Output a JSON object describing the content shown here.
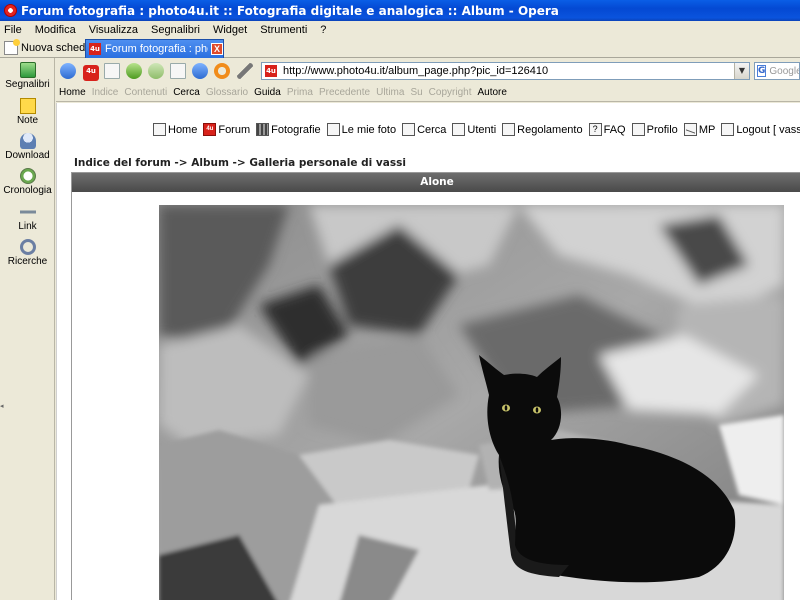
{
  "window": {
    "title": "Forum fotografia : photo4u.it :: Fotografia digitale e analogica :: Album - Opera"
  },
  "menu": [
    "File",
    "Modifica",
    "Visualizza",
    "Segnalibri",
    "Widget",
    "Strumenti",
    "?"
  ],
  "tabs": {
    "new_tab_label": "Nuova scheda",
    "active_tab_title": "Forum fotografia : photo...",
    "site_icon_text": "4u",
    "close_symbol": "X"
  },
  "panel": {
    "items": [
      "Segnalibri",
      "Note",
      "Download",
      "Cronologia",
      "Link",
      "Ricerche"
    ]
  },
  "address": {
    "url": "http://www.photo4u.it/album_page.php?pic_id=126410",
    "dropdown_symbol": "▼",
    "search_engine_icon": "G",
    "search_placeholder": "Google"
  },
  "navbar": {
    "items": [
      {
        "label": "Home",
        "enabled": true
      },
      {
        "label": "Indice",
        "enabled": false
      },
      {
        "label": "Contenuti",
        "enabled": false
      },
      {
        "label": "Cerca",
        "enabled": true
      },
      {
        "label": "Glossario",
        "enabled": false
      },
      {
        "label": "Guida",
        "enabled": true
      },
      {
        "label": "Prima",
        "enabled": false
      },
      {
        "label": "Precedente",
        "enabled": false
      },
      {
        "label": "Ultima",
        "enabled": false
      },
      {
        "label": "Su",
        "enabled": false
      },
      {
        "label": "Copyright",
        "enabled": false
      },
      {
        "label": "Autore",
        "enabled": true
      }
    ]
  },
  "forum": {
    "links": [
      {
        "label": "Home",
        "icon": "home-icon"
      },
      {
        "label": "Forum",
        "icon": "forum-logo-icon",
        "icon_text": "4u"
      },
      {
        "label": "Fotografie",
        "icon": "film-icon"
      },
      {
        "label": "Le mie foto",
        "icon": "my-photos-icon"
      },
      {
        "label": "Cerca",
        "icon": "search-icon"
      },
      {
        "label": "Utenti",
        "icon": "users-icon"
      },
      {
        "label": "Regolamento",
        "icon": "rules-icon"
      },
      {
        "label": "FAQ",
        "icon": "faq-icon",
        "icon_text": "?"
      },
      {
        "label": "Profilo",
        "icon": "profile-icon"
      },
      {
        "label": "MP",
        "icon": "mail-icon"
      },
      {
        "label": "Logout [ vassi ]",
        "icon": "logout-icon"
      }
    ],
    "breadcrumb": "Indice del forum -> Album -> Galleria personale di vassi",
    "album_title": "Alone"
  },
  "colors": {
    "title_bar": "#0a53dd",
    "album_header": "#555555",
    "site_icon": "#d8221b"
  }
}
